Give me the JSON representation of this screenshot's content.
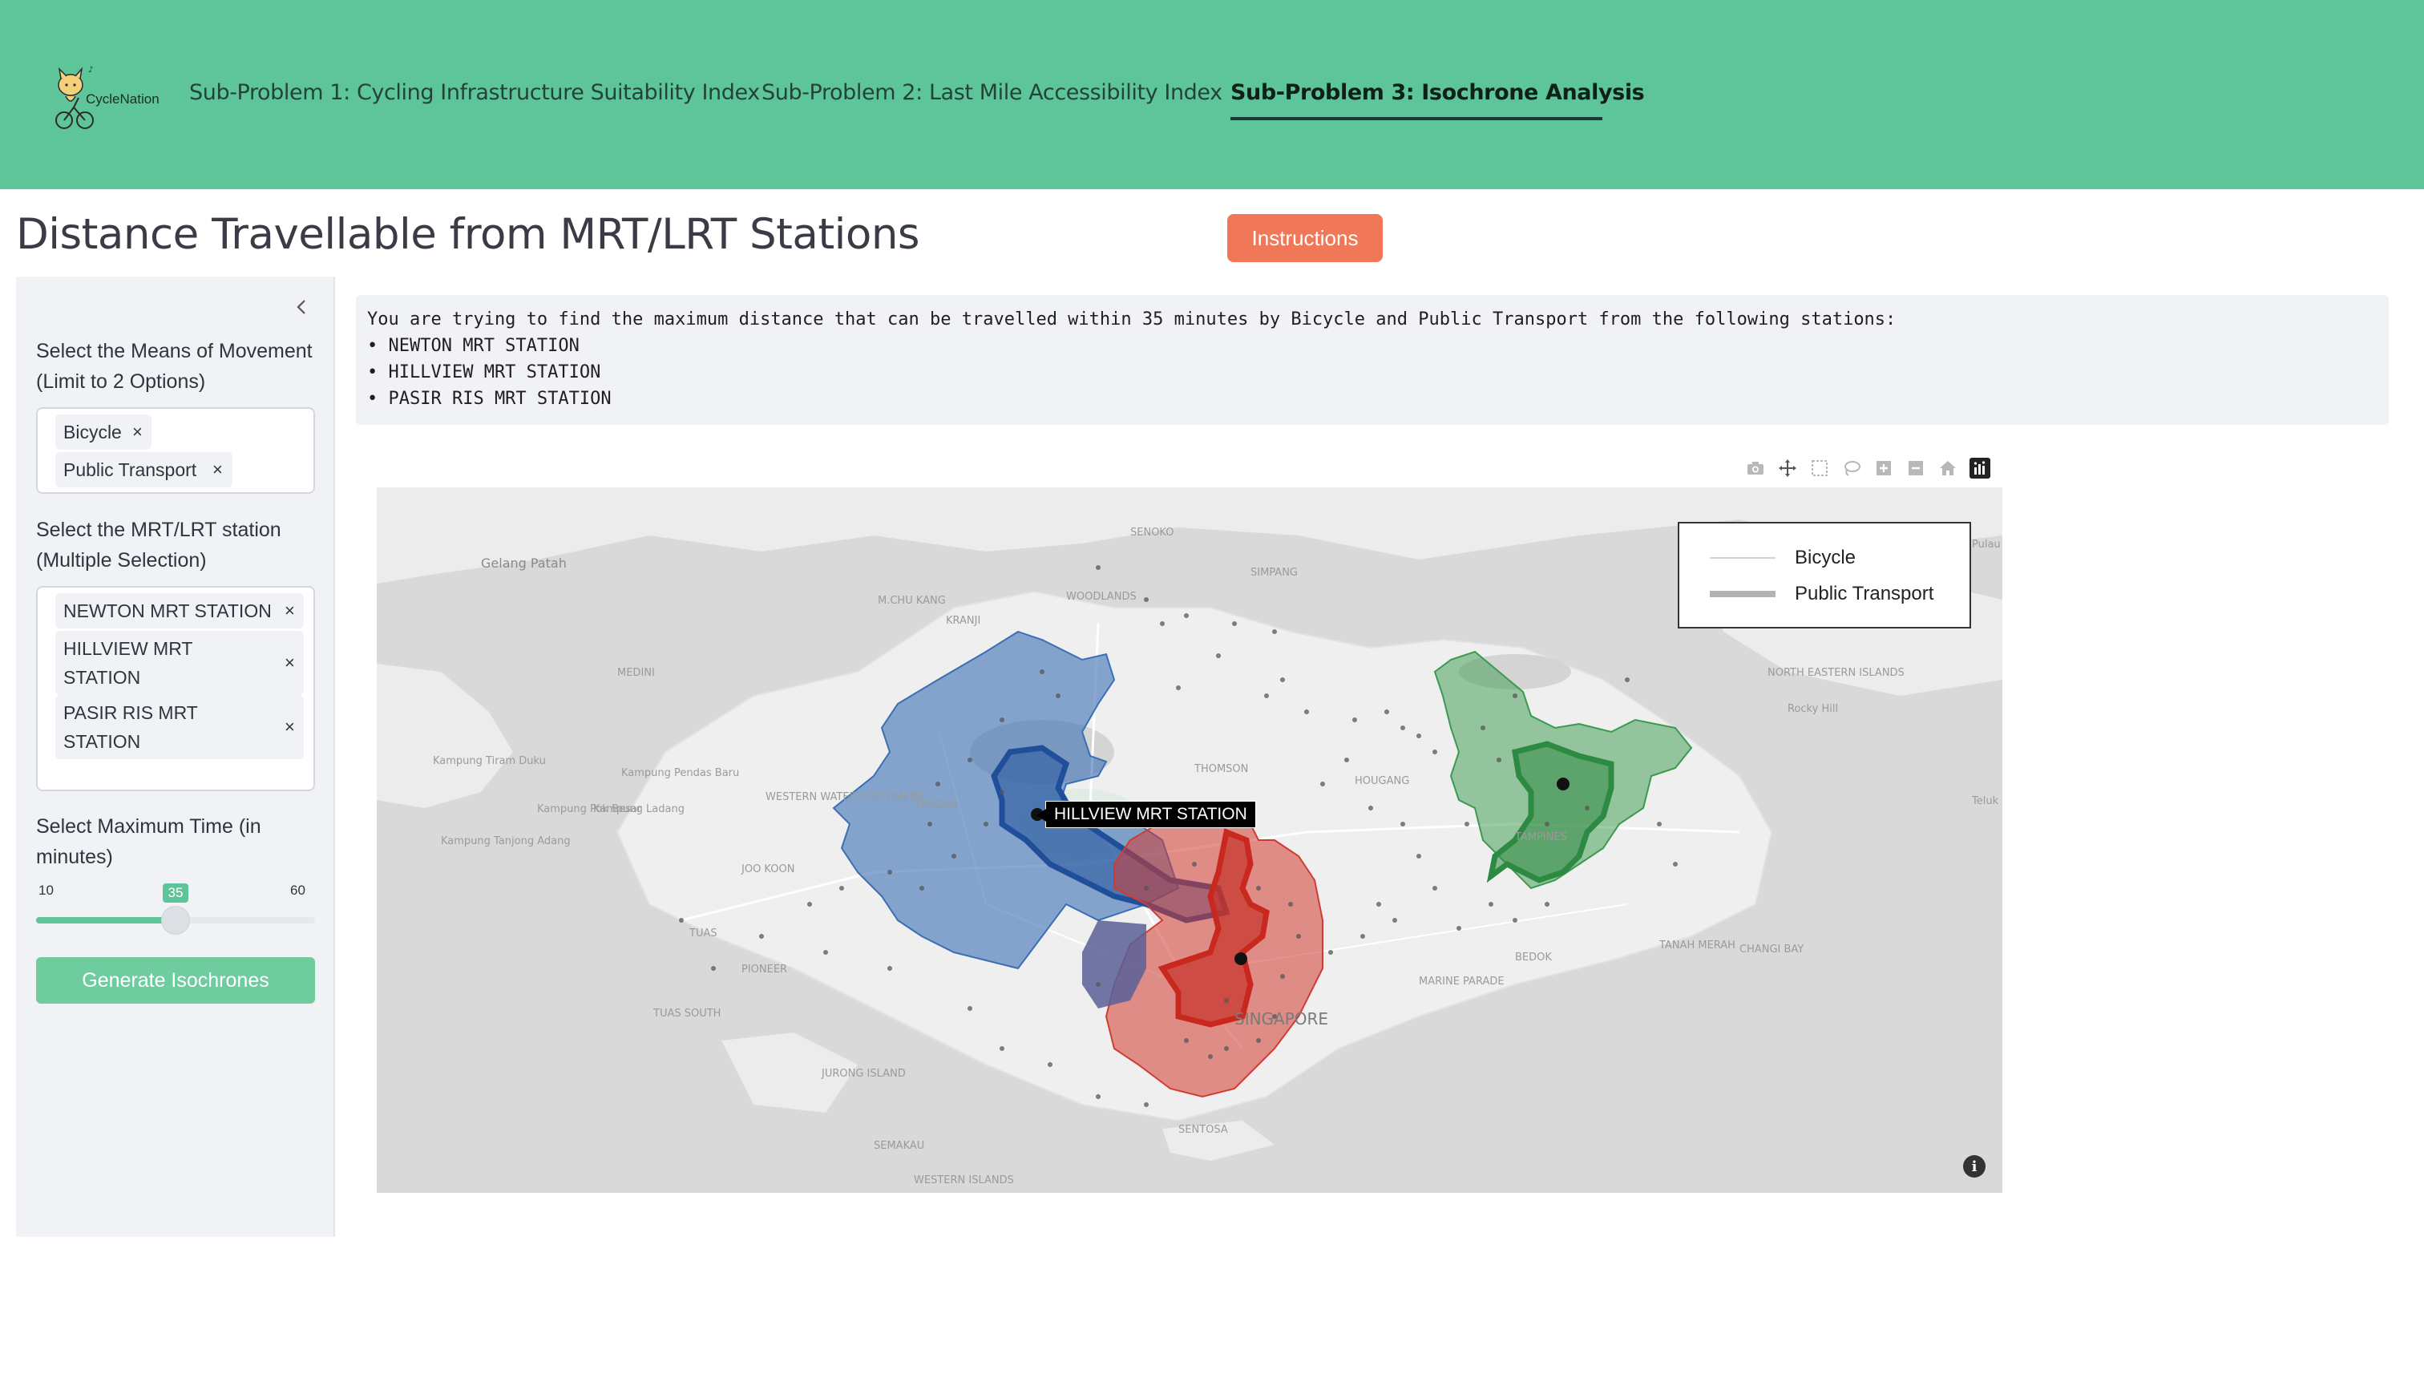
{
  "brand": {
    "name": "CycleNation",
    "logo_icon": "cat-on-bicycle-logo"
  },
  "nav": {
    "items": [
      {
        "label": "Sub-Problem 1: Cycling Infrastructure Suitability Index",
        "active": false
      },
      {
        "label": "Sub-Problem 2: Last Mile Accessibility Index",
        "active": false
      },
      {
        "label": "Sub-Problem 3: Isochrone Analysis",
        "active": true
      }
    ]
  },
  "page": {
    "title": "Distance Travellable from MRT/LRT Stations",
    "instructions_label": "Instructions"
  },
  "sidebar": {
    "collapse_icon": "chevron-left-icon",
    "movement": {
      "label": "Select the Means of Movement (Limit to 2 Options)",
      "selected": [
        "Bicycle",
        "Public Transport"
      ]
    },
    "stations": {
      "label": "Select the MRT/LRT station (Multiple Selection)",
      "selected": [
        "NEWTON MRT STATION",
        "HILLVIEW MRT STATION",
        "PASIR RIS MRT STATION"
      ]
    },
    "time": {
      "label": "Select Maximum Time (in minutes)",
      "min": "10",
      "max": "60",
      "value": "35",
      "fraction": 0.5
    },
    "generate_label": "Generate Isochrones"
  },
  "info": {
    "lines": [
      "You are trying to find the maximum distance that can be travelled within 35 minutes by Bicycle and Public Transport from the following stations:",
      "• NEWTON MRT STATION",
      "• HILLVIEW MRT STATION",
      "• PASIR RIS MRT STATION"
    ]
  },
  "map": {
    "legend": [
      {
        "label": "Bicycle",
        "style": "thin"
      },
      {
        "label": "Public Transport",
        "style": "thick"
      }
    ],
    "tooltip": "HILLVIEW MRT STATION",
    "colors": {
      "blue": "#3a6fb5",
      "red": "#d23b32",
      "green": "#3a9a4e",
      "water": "#d7d7d7",
      "land": "#ececec"
    },
    "place_labels": [
      "Gelang Patah",
      "SENOKO",
      "WOODLANDS",
      "SIMPANG",
      "KRANJI",
      "M.CHU KANG",
      "MEDINI",
      "Pulau Sur",
      "NORTH EASTERN ISLANDS",
      "Rocky Hill",
      "Kampung Tiram Duku",
      "Kampung Pendas Baru",
      "Kampung Pok Besar",
      "Kampung Ladang",
      "Kampung Tanjong Adang",
      "WESTERN WATER CATCHMENT",
      "TENGAH",
      "THOMSON",
      "HOUGANG",
      "TAMPINES",
      "TANAH MERAH",
      "CHANGI BAY",
      "Teluk",
      "JOO KOON",
      "TUAS",
      "PIONEER",
      "TUAS SOUTH",
      "JURONG ISLAND",
      "SEMAKAU",
      "WESTERN ISLANDS",
      "SENTOSA",
      "SINGAPORE",
      "MARINE PARADE",
      "BEDOK"
    ],
    "modebar_icons": [
      "camera-icon",
      "pan-icon",
      "box-select-icon",
      "lasso-icon",
      "zoom-in-icon",
      "zoom-out-icon",
      "home-icon",
      "plotly-logo-icon"
    ]
  }
}
